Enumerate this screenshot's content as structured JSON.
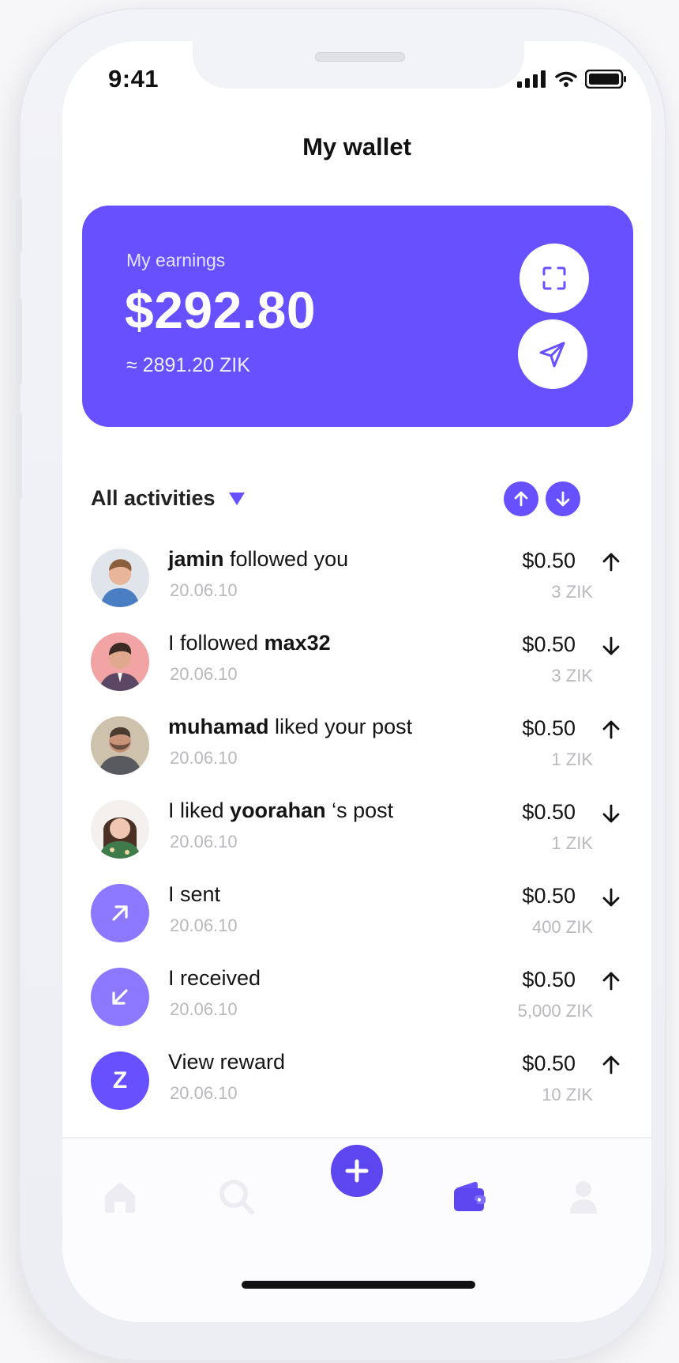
{
  "status_bar": {
    "time": "9:41"
  },
  "header": {
    "title": "My wallet"
  },
  "wallet": {
    "label": "My earnings",
    "amount": "$292.80",
    "token_equivalent": "≈ 2891.20 ZIK"
  },
  "filter": {
    "label": "All activities"
  },
  "activities": [
    {
      "user": "jamin",
      "text_after": " followed you",
      "date": "20.06.10",
      "amount": "$0.50",
      "token": "3 ZIK",
      "direction": "up"
    },
    {
      "text_before": "I followed ",
      "user": "max32",
      "date": "20.06.10",
      "amount": "$0.50",
      "token": "3 ZIK",
      "direction": "down"
    },
    {
      "user": "muhamad",
      "text_after": " liked your post",
      "date": "20.06.10",
      "amount": "$0.50",
      "token": "1 ZIK",
      "direction": "up"
    },
    {
      "text_before": "I liked ",
      "user": "yoorahan",
      "text_after": " ‘s post",
      "date": "20.06.10",
      "amount": "$0.50",
      "token": "1 ZIK",
      "direction": "down"
    },
    {
      "text": "I sent",
      "date": "20.06.10",
      "amount": "$0.50",
      "token": "400 ZIK",
      "direction": "down"
    },
    {
      "text": "I received",
      "date": "20.06.10",
      "amount": "$0.50",
      "token": "5,000 ZIK",
      "direction": "up"
    },
    {
      "text": "View reward",
      "date": "20.06.10",
      "amount": "$0.50",
      "token": "10 ZIK",
      "direction": "up",
      "badge_letter": "Z"
    }
  ],
  "theme": {
    "accent": "#6650ff"
  },
  "icons": {
    "scan": "scan-icon",
    "send": "send-icon",
    "sort_up": "arrow-up-icon",
    "sort_down": "arrow-down-icon",
    "home": "home-icon",
    "search": "search-icon",
    "add": "plus-icon",
    "wallet": "wallet-icon",
    "profile": "profile-icon"
  }
}
